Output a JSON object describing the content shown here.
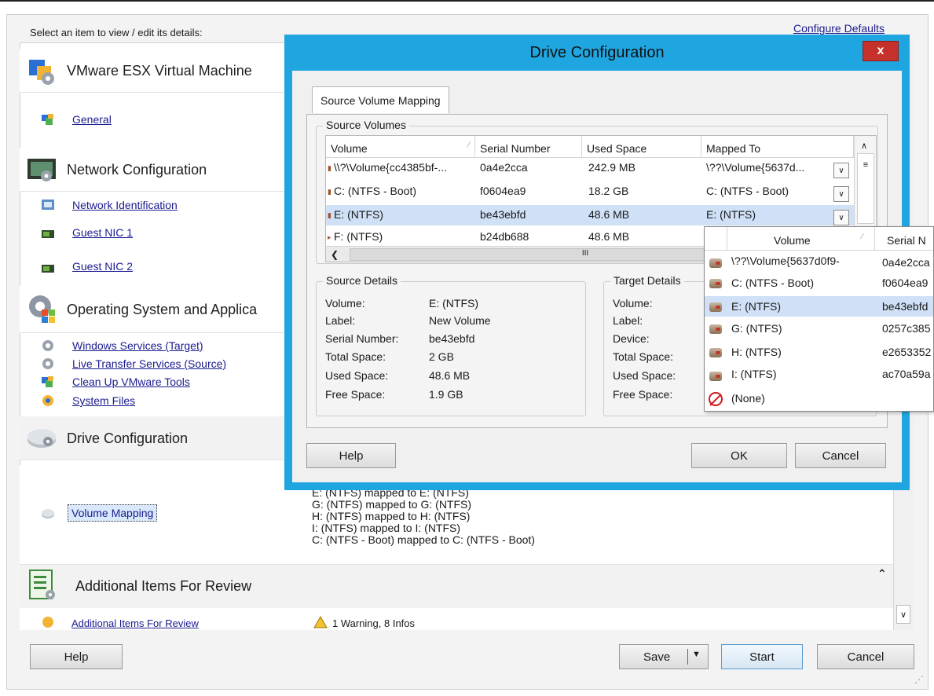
{
  "header": {
    "select_prompt": "Select an item to view / edit its details:",
    "configure_defaults": "Configure Defaults"
  },
  "sections": {
    "vmware": "VMware ESX Virtual Machine",
    "general": "General",
    "network": "Network Configuration",
    "network_items": [
      "Network Identification",
      "Guest NIC 1",
      "Guest NIC 2"
    ],
    "os": "Operating System and Applica",
    "os_items": [
      "Windows Services (Target)",
      "Live Transfer Services (Source)",
      "Clean Up VMware Tools",
      "System Files"
    ],
    "drive": "Drive Configuration",
    "volume_mapping": "Volume Mapping",
    "additional": "Additional Items For Review",
    "additional_item": "Additional Items For Review"
  },
  "mapping_summary": [
    "E: (NTFS) mapped to E: (NTFS)",
    "G: (NTFS) mapped to G: (NTFS)",
    "H: (NTFS) mapped to H: (NTFS)",
    "I: (NTFS) mapped to I: (NTFS)",
    "C: (NTFS - Boot) mapped to C: (NTFS - Boot)"
  ],
  "warnings": "1 Warning, 8 Infos",
  "main_buttons": {
    "help": "Help",
    "save": "Save",
    "start": "Start",
    "cancel": "Cancel"
  },
  "dialog": {
    "title": "Drive Configuration",
    "close": "x",
    "tab": "Source Volume Mapping",
    "source_volumes_label": "Source Volumes",
    "columns": [
      "Volume",
      "Serial Number",
      "Used Space",
      "Mapped To"
    ],
    "rows": [
      {
        "volume": "\\\\?\\Volume{cc4385bf-...",
        "serial": "0a4e2cca",
        "used": "242.9 MB",
        "mapped": "\\??\\Volume{5637d..."
      },
      {
        "volume": "C: (NTFS - Boot)",
        "serial": "f0604ea9",
        "used": "18.2 GB",
        "mapped": "C: (NTFS - Boot)"
      },
      {
        "volume": "E: (NTFS)",
        "serial": "be43ebfd",
        "used": "48.6 MB",
        "mapped": "E: (NTFS)"
      },
      {
        "volume": "F: (NTFS)",
        "serial": "b24db688",
        "used": "48.6 MB",
        "mapped": ""
      }
    ],
    "source_details": {
      "label": "Source Details",
      "keys": [
        "Volume:",
        "Label:",
        "Serial Number:",
        "Total Space:",
        "Used Space:",
        "Free Space:"
      ],
      "values": [
        "E: (NTFS)",
        "New Volume",
        "be43ebfd",
        "2 GB",
        "48.6 MB",
        "1.9 GB"
      ]
    },
    "target_details": {
      "label": "Target Details",
      "keys": [
        "Volume:",
        "Label:",
        "Device:",
        "Total Space:",
        "Used Space:",
        "Free Space:"
      ]
    },
    "buttons": {
      "help": "Help",
      "ok": "OK",
      "cancel": "Cancel"
    },
    "scroll_mid": "III"
  },
  "dropdown": {
    "columns": [
      "Volume",
      "Serial N"
    ],
    "rows": [
      {
        "volume": "\\??\\Volume{5637d0f9-",
        "serial": "0a4e2cca"
      },
      {
        "volume": "C: (NTFS - Boot)",
        "serial": "f0604ea9"
      },
      {
        "volume": "E: (NTFS)",
        "serial": "be43ebfd"
      },
      {
        "volume": "G: (NTFS)",
        "serial": "0257c385"
      },
      {
        "volume": "H: (NTFS)",
        "serial": "e2653352"
      },
      {
        "volume": "I: (NTFS)",
        "serial": "ac70a59a"
      },
      {
        "volume": "(None)",
        "serial": ""
      }
    ]
  },
  "colors": {
    "dialog_frame": "#1fa6e0",
    "selection": "#cfe0f7",
    "close": "#c7312b",
    "link": "#1b1b8f"
  }
}
